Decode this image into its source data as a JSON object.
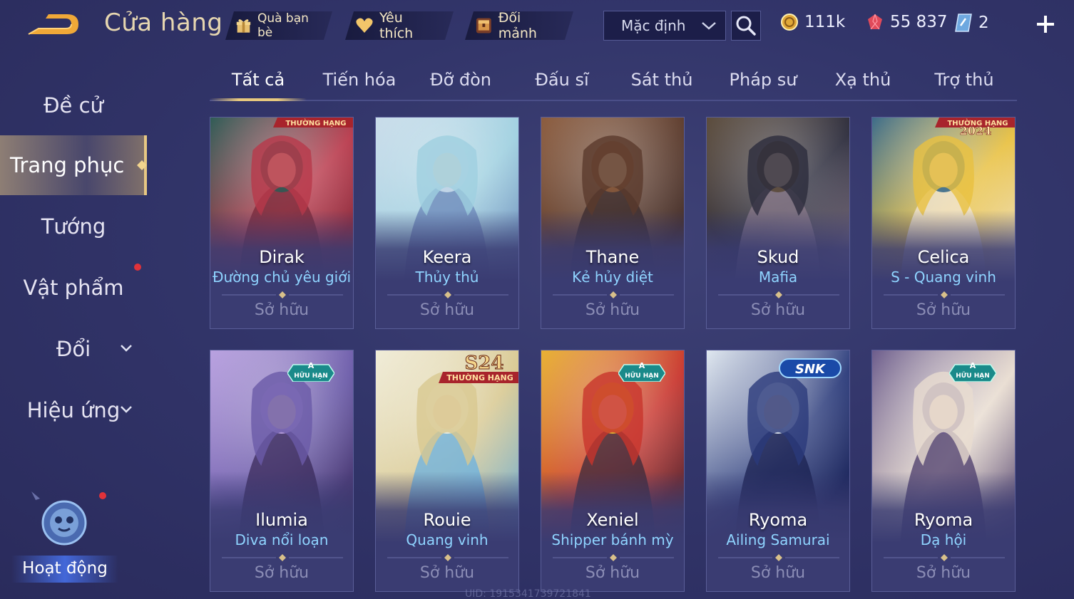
{
  "header": {
    "title": "Cửa hàng",
    "pills": {
      "gift": "Quà bạn bè",
      "favorite": "Yêu thích",
      "shard": "Đổi mảnh"
    },
    "sort_value": "Mặc định",
    "currencies": {
      "gold": "111k",
      "ruby": "55 837",
      "ticket": "2"
    }
  },
  "sidebar": {
    "items": [
      {
        "label": "Đề cử"
      },
      {
        "label": "Trang phục"
      },
      {
        "label": "Tướng"
      },
      {
        "label": "Vật phẩm"
      },
      {
        "label": "Đổi"
      },
      {
        "label": "Hiệu ứng"
      }
    ],
    "activity_label": "Hoạt động"
  },
  "tabs": [
    "Tất cả",
    "Tiến hóa",
    "Đỡ đòn",
    "Đấu sĩ",
    "Sát thủ",
    "Pháp sư",
    "Xạ thủ",
    "Trợ thủ"
  ],
  "badges": {
    "rank": "THƯỜNG HẠNG",
    "year": "2024",
    "limited_top": "A",
    "limited": "HỮU HẠN",
    "season": "S24",
    "snk": "SNK"
  },
  "cards": [
    {
      "hero": "Dirak",
      "skin": "Đường chủ yêu giới",
      "status": "Sở hữu",
      "colors": [
        "#b8384a",
        "#2d5a54",
        "#7a2838"
      ]
    },
    {
      "hero": "Keera",
      "skin": "Thủy thủ",
      "status": "Sở hữu",
      "colors": [
        "#9fd0e0",
        "#c9dcea",
        "#6a86b8"
      ]
    },
    {
      "hero": "Thane",
      "skin": "Kẻ hủy diệt",
      "status": "Sở hữu",
      "colors": [
        "#5a3a2c",
        "#8a5a3c",
        "#3a2a2a"
      ]
    },
    {
      "hero": "Skud",
      "skin": "Mafia",
      "status": "Sở hữu",
      "colors": [
        "#2c2c3c",
        "#5a4a3a",
        "#8a7a8a"
      ]
    },
    {
      "hero": "Celica",
      "skin": "S - Quang vinh",
      "status": "Sở hữu",
      "colors": [
        "#e8c040",
        "#3a6a88",
        "#f0e6d8"
      ]
    },
    {
      "hero": "Ilumia",
      "skin": "Diva nổi loạn",
      "status": "Sở hữu",
      "colors": [
        "#6a5aa8",
        "#b8a0e0",
        "#3a2a5a"
      ]
    },
    {
      "hero": "Rouie",
      "skin": "Quang vinh",
      "status": "Sở hữu",
      "colors": [
        "#d8c890",
        "#f0ecd8",
        "#6ab0e0"
      ]
    },
    {
      "hero": "Xeniel",
      "skin": "Shipper bánh mỳ",
      "status": "Sở hữu",
      "colors": [
        "#c8342c",
        "#e8b030",
        "#3a2a3a"
      ]
    },
    {
      "hero": "Ryoma",
      "skin": "Ailing Samurai",
      "status": "Sở hữu",
      "colors": [
        "#2a3a7a",
        "#e0e8f0",
        "#1a2050"
      ]
    },
    {
      "hero": "Ryoma",
      "skin": "Dạ hội",
      "status": "Sở hữu",
      "colors": [
        "#e8dcd0",
        "#6a5a8a",
        "#4a3a6a"
      ]
    }
  ],
  "uid": "UID: 1915341739721841",
  "icons": {
    "back": "back-arrow-icon",
    "gift": "gift-icon",
    "heart": "heart-icon",
    "shard": "chest-icon",
    "search": "search-icon",
    "gold": "gold-coin-icon",
    "ruby": "ruby-gem-icon",
    "ticket": "ticket-icon",
    "plus": "plus-icon"
  },
  "colors": {
    "accent_gold": "#e8c97e",
    "skin_name": "#8fd4ff",
    "notification": "#e0323a"
  }
}
